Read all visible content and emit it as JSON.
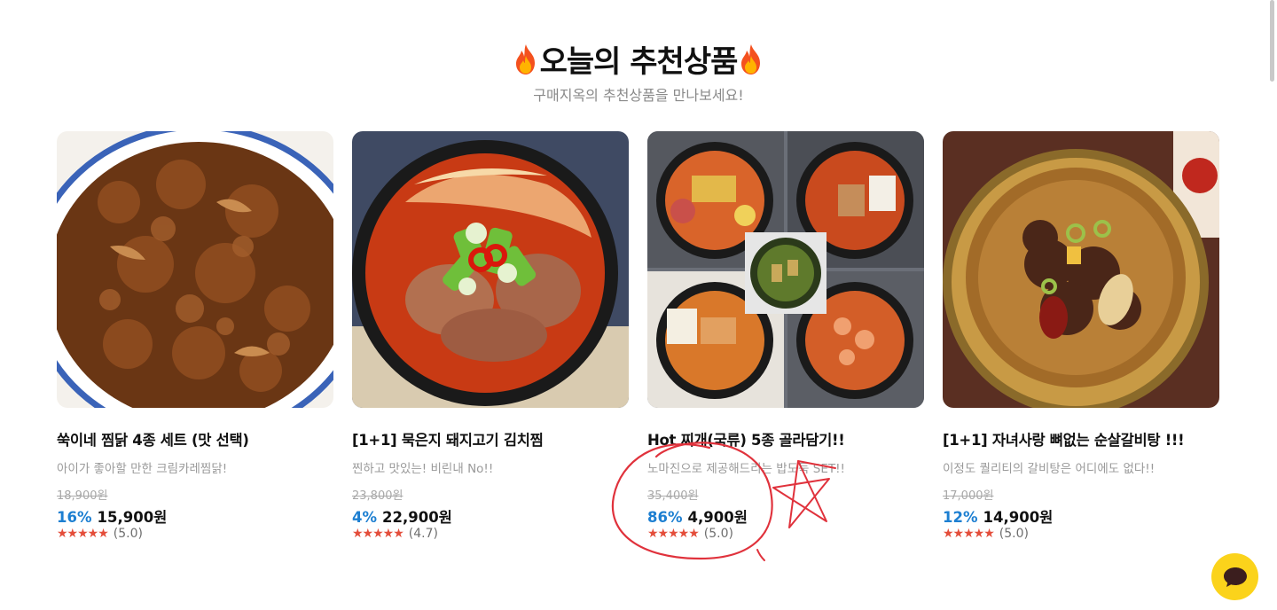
{
  "section": {
    "title": "오늘의 추천상품",
    "subtitle": "구매지옥의 추천상품을 만나보세요!"
  },
  "products": [
    {
      "name": "쑥이네 찜닭 4종 세트 (맛 선택)",
      "description": "아이가 좋아할 만한 크림카레찜닭!",
      "original_price": "18,900원",
      "discount": "16%",
      "price": "15,900원",
      "stars": "★★★★★",
      "rating": "(5.0)"
    },
    {
      "name": "[1+1] 묵은지 돼지고기 김치찜",
      "description": "찐하고 맛있는! 비린내 No!!",
      "original_price": "23,800원",
      "discount": "4%",
      "price": "22,900원",
      "stars": "★★★★★",
      "rating": "(4.7)"
    },
    {
      "name": "Hot 찌개(국류) 5종 골라담기!!",
      "description": "노마진으로 제공해드리는 밥도둑 SET!!",
      "original_price": "35,400원",
      "discount": "86%",
      "price": "4,900원",
      "stars": "★★★★★",
      "rating": "(5.0)"
    },
    {
      "name": "[1+1] 자녀사랑 뼈없는 순살갈비탕 !!!",
      "description": "이정도 퀄리티의 갈비탕은 어디에도 없다!!",
      "original_price": "17,000원",
      "discount": "12%",
      "price": "14,900원",
      "stars": "★★★★★",
      "rating": "(5.0)"
    }
  ],
  "colors": {
    "discount": "#1d7fd1",
    "stars": "#e44d3a",
    "chat_button": "#fbd31b",
    "annotation": "#e0323c"
  },
  "icons": {
    "title_decoration": "fire-icon",
    "chat": "chat-bubble-icon"
  }
}
